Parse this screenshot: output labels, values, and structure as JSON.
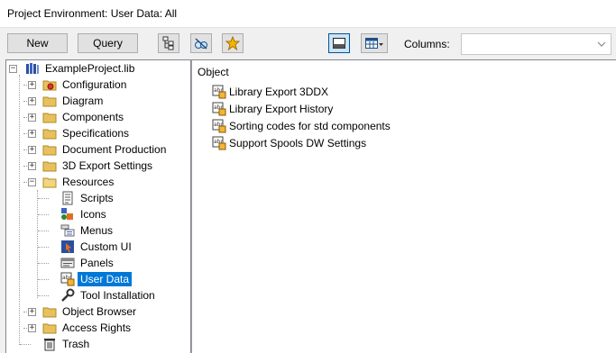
{
  "window": {
    "title": "Project Environment: User Data: All"
  },
  "toolbar": {
    "new_label": "New",
    "query_label": "Query",
    "columns_label": "Columns:",
    "columns_value": ""
  },
  "tree": {
    "root": "ExampleProject.lib",
    "items": [
      "Configuration",
      "Diagram",
      "Components",
      "Specifications",
      "Document Production",
      "3D Export Settings",
      "Resources"
    ],
    "resources_children": [
      "Scripts",
      "Icons",
      "Menus",
      "Custom UI",
      "Panels",
      "User Data",
      "Tool Installation"
    ],
    "after_items": [
      "Object Browser",
      "Access Rights",
      "Trash"
    ]
  },
  "objects": {
    "header": "Object",
    "items": [
      "Library Export 3DDX",
      "Library Export History",
      "Sorting codes for std components",
      "Support Spools DW Settings"
    ]
  },
  "colors": {
    "selection": "#0078d7",
    "folder": "#e8c15c"
  }
}
